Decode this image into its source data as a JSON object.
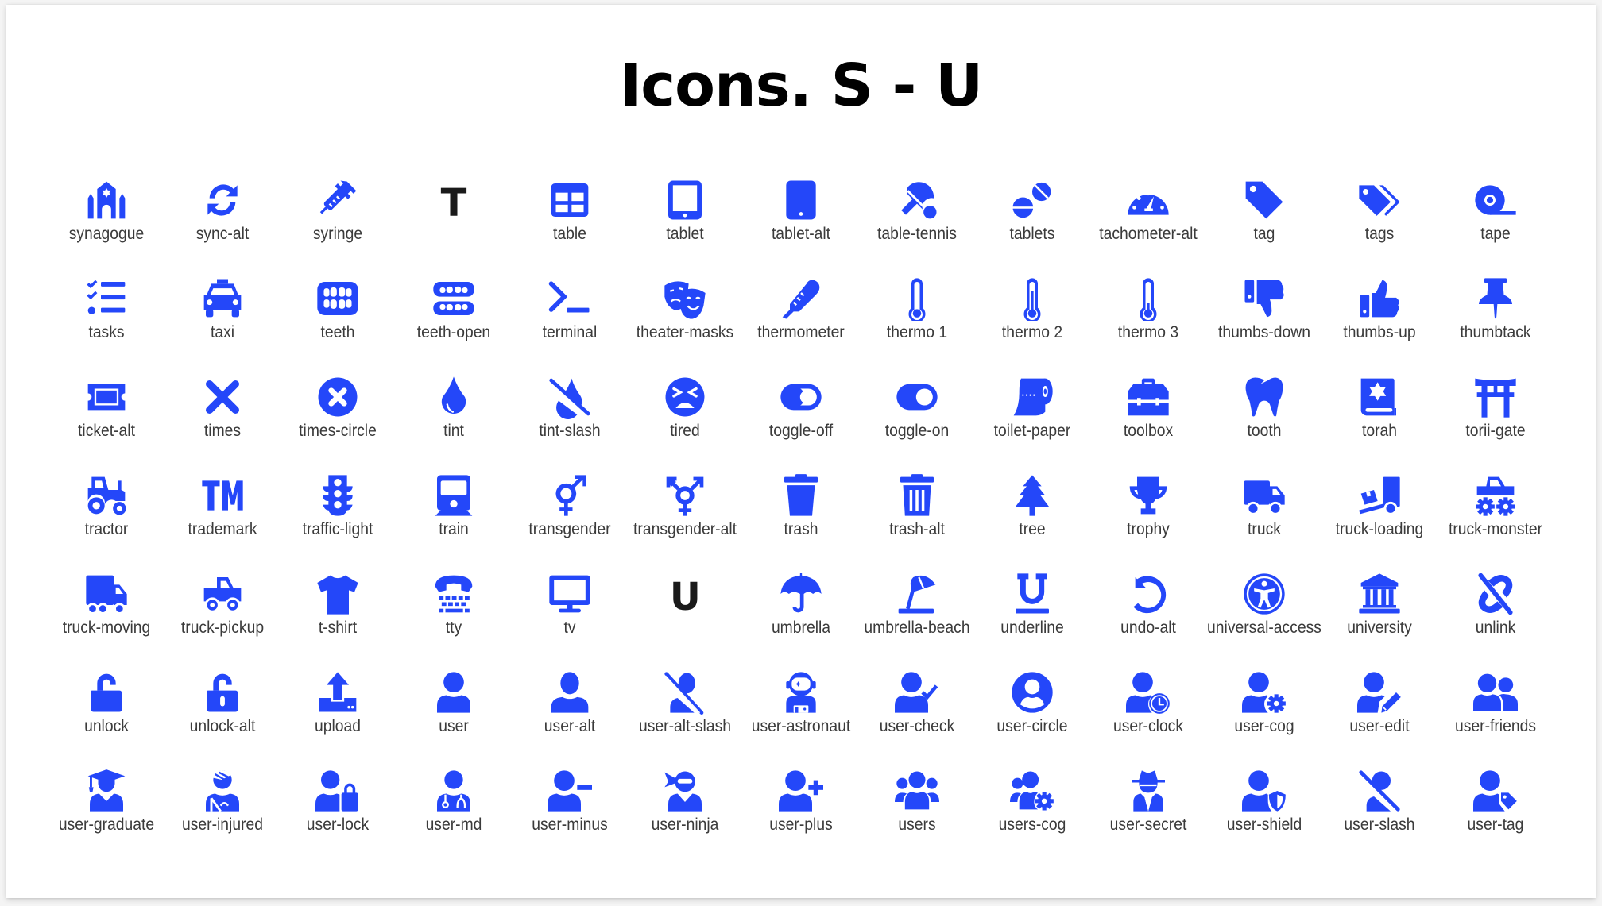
{
  "page": {
    "title": "Icons. S - U",
    "icon_color": "#2447F9",
    "label_color": "#3b3b3b"
  },
  "grid": {
    "columns": 13,
    "rows": [
      [
        {
          "label": "synagogue",
          "icon": "synagogue-icon"
        },
        {
          "label": "sync-alt",
          "icon": "sync-alt-icon"
        },
        {
          "label": "syringe",
          "icon": "syringe-icon"
        },
        {
          "label": "",
          "icon": "placeholder-t-glyph",
          "glyph": "T"
        },
        {
          "label": "table",
          "icon": "table-icon"
        },
        {
          "label": "tablet",
          "icon": "tablet-icon"
        },
        {
          "label": "tablet-alt",
          "icon": "tablet-alt-icon"
        },
        {
          "label": "table-tennis",
          "icon": "table-tennis-icon"
        },
        {
          "label": "tablets",
          "icon": "tablets-icon"
        },
        {
          "label": "tachometer-alt",
          "icon": "tachometer-alt-icon"
        },
        {
          "label": "tag",
          "icon": "tag-icon"
        },
        {
          "label": "tags",
          "icon": "tags-icon"
        },
        {
          "label": "tape",
          "icon": "tape-icon"
        }
      ],
      [
        {
          "label": "tasks",
          "icon": "tasks-icon"
        },
        {
          "label": "taxi",
          "icon": "taxi-icon"
        },
        {
          "label": "teeth",
          "icon": "teeth-icon"
        },
        {
          "label": "teeth-open",
          "icon": "teeth-open-icon"
        },
        {
          "label": "terminal",
          "icon": "terminal-icon"
        },
        {
          "label": "theater-masks",
          "icon": "theater-masks-icon"
        },
        {
          "label": "thermometer",
          "icon": "thermometer-icon"
        },
        {
          "label": "thermo 1",
          "icon": "thermometer-1-icon"
        },
        {
          "label": "thermo 2",
          "icon": "thermometer-2-icon"
        },
        {
          "label": "thermo 3",
          "icon": "thermometer-3-icon"
        },
        {
          "label": "thumbs-down",
          "icon": "thumbs-down-icon"
        },
        {
          "label": "thumbs-up",
          "icon": "thumbs-up-icon"
        },
        {
          "label": "thumbtack",
          "icon": "thumbtack-icon"
        }
      ],
      [
        {
          "label": "ticket-alt",
          "icon": "ticket-alt-icon"
        },
        {
          "label": "times",
          "icon": "times-icon"
        },
        {
          "label": "times-circle",
          "icon": "times-circle-icon"
        },
        {
          "label": "tint",
          "icon": "tint-icon"
        },
        {
          "label": "tint-slash",
          "icon": "tint-slash-icon"
        },
        {
          "label": "tired",
          "icon": "tired-icon"
        },
        {
          "label": "toggle-off",
          "icon": "toggle-off-icon"
        },
        {
          "label": "toggle-on",
          "icon": "toggle-on-icon"
        },
        {
          "label": "toilet-paper",
          "icon": "toilet-paper-icon"
        },
        {
          "label": "toolbox",
          "icon": "toolbox-icon"
        },
        {
          "label": "tooth",
          "icon": "tooth-icon"
        },
        {
          "label": "torah",
          "icon": "torah-icon"
        },
        {
          "label": "torii-gate",
          "icon": "torii-gate-icon"
        }
      ],
      [
        {
          "label": "tractor",
          "icon": "tractor-icon"
        },
        {
          "label": "trademark",
          "icon": "trademark-icon"
        },
        {
          "label": "traffic-light",
          "icon": "traffic-light-icon"
        },
        {
          "label": "train",
          "icon": "train-icon"
        },
        {
          "label": "transgender",
          "icon": "transgender-icon"
        },
        {
          "label": "transgender-alt",
          "icon": "transgender-alt-icon"
        },
        {
          "label": "trash",
          "icon": "trash-icon"
        },
        {
          "label": "trash-alt",
          "icon": "trash-alt-icon"
        },
        {
          "label": "tree",
          "icon": "tree-icon"
        },
        {
          "label": "trophy",
          "icon": "trophy-icon"
        },
        {
          "label": "truck",
          "icon": "truck-icon"
        },
        {
          "label": "truck-loading",
          "icon": "truck-loading-icon"
        },
        {
          "label": "truck-monster",
          "icon": "truck-monster-icon"
        }
      ],
      [
        {
          "label": "truck-moving",
          "icon": "truck-moving-icon"
        },
        {
          "label": "truck-pickup",
          "icon": "truck-pickup-icon"
        },
        {
          "label": "t-shirt",
          "icon": "t-shirt-icon"
        },
        {
          "label": "tty",
          "icon": "tty-icon"
        },
        {
          "label": "tv",
          "icon": "tv-icon"
        },
        {
          "label": "",
          "icon": "placeholder-u-glyph",
          "glyph": "U"
        },
        {
          "label": "umbrella",
          "icon": "umbrella-icon"
        },
        {
          "label": "umbrella-beach",
          "icon": "umbrella-beach-icon"
        },
        {
          "label": "underline",
          "icon": "underline-icon"
        },
        {
          "label": "undo-alt",
          "icon": "undo-alt-icon"
        },
        {
          "label": "universal-access",
          "icon": "universal-access-icon"
        },
        {
          "label": "university",
          "icon": "university-icon"
        },
        {
          "label": "unlink",
          "icon": "unlink-icon"
        }
      ],
      [
        {
          "label": "unlock",
          "icon": "unlock-icon"
        },
        {
          "label": "unlock-alt",
          "icon": "unlock-alt-icon"
        },
        {
          "label": "upload",
          "icon": "upload-icon"
        },
        {
          "label": "user",
          "icon": "user-icon"
        },
        {
          "label": "user-alt",
          "icon": "user-alt-icon"
        },
        {
          "label": "user-alt-slash",
          "icon": "user-alt-slash-icon"
        },
        {
          "label": "user-astronaut",
          "icon": "user-astronaut-icon"
        },
        {
          "label": "user-check",
          "icon": "user-check-icon"
        },
        {
          "label": "user-circle",
          "icon": "user-circle-icon"
        },
        {
          "label": "user-clock",
          "icon": "user-clock-icon"
        },
        {
          "label": "user-cog",
          "icon": "user-cog-icon"
        },
        {
          "label": "user-edit",
          "icon": "user-edit-icon"
        },
        {
          "label": "user-friends",
          "icon": "user-friends-icon"
        }
      ],
      [
        {
          "label": "user-graduate",
          "icon": "user-graduate-icon"
        },
        {
          "label": "user-injured",
          "icon": "user-injured-icon"
        },
        {
          "label": "user-lock",
          "icon": "user-lock-icon"
        },
        {
          "label": "user-md",
          "icon": "user-md-icon"
        },
        {
          "label": "user-minus",
          "icon": "user-minus-icon"
        },
        {
          "label": "user-ninja",
          "icon": "user-ninja-icon"
        },
        {
          "label": "user-plus",
          "icon": "user-plus-icon"
        },
        {
          "label": "users",
          "icon": "users-icon"
        },
        {
          "label": "users-cog",
          "icon": "users-cog-icon"
        },
        {
          "label": "user-secret",
          "icon": "user-secret-icon"
        },
        {
          "label": "user-shield",
          "icon": "user-shield-icon"
        },
        {
          "label": "user-slash",
          "icon": "user-slash-icon"
        },
        {
          "label": "user-tag",
          "icon": "user-tag-icon"
        }
      ]
    ]
  }
}
